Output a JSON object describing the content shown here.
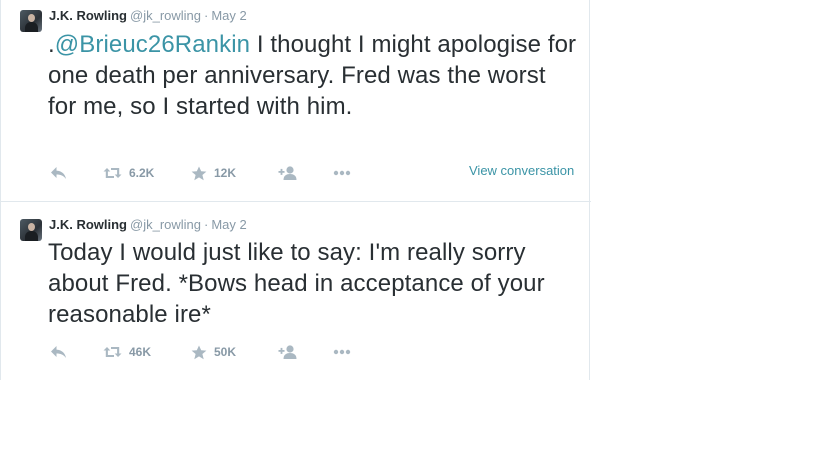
{
  "tweets": [
    {
      "fullname": "J.K. Rowling",
      "username": "@jk_rowling",
      "separator": "·",
      "time": "May 2",
      "text_prefix": ".",
      "mention": "@Brieuc26Rankin",
      "text_rest": " I thought I might apologise for one death per anniversary. Fred was the worst for me, so I started with him.",
      "retweets": "6.2K",
      "favorites": "12K",
      "view_conversation": "View conversation"
    },
    {
      "fullname": "J.K. Rowling",
      "username": "@jk_rowling",
      "separator": "·",
      "time": "May 2",
      "text": "Today I would just like to say: I'm really sorry about Fred. *Bows head in acceptance of your reasonable ire*",
      "retweets": "46K",
      "favorites": "50K"
    }
  ],
  "icons": {
    "reply": "reply-icon",
    "retweet": "retweet-icon",
    "favorite": "star-icon",
    "follow": "follow-icon",
    "more": "more-icon"
  },
  "colors": {
    "link": "#3b94a6",
    "text": "#292f33",
    "muted": "#8899a6",
    "icon": "#aab8c2"
  }
}
